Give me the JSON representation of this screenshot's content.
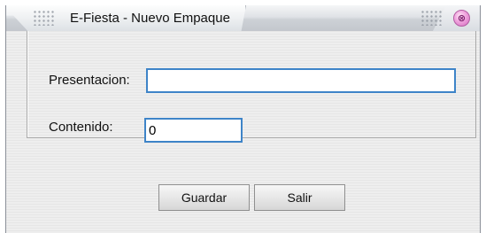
{
  "window": {
    "title": "E-Fiesta - Nuevo Empaque",
    "close_glyph": "⊗"
  },
  "form": {
    "presentacion_label": "Presentacion:",
    "presentacion_value": "",
    "contenido_label": "Contenido:",
    "contenido_value": "0"
  },
  "buttons": {
    "guardar_label": "Guardar",
    "salir_label": "Salir"
  },
  "icons": {
    "title_grip_left": "grip-dots-icon",
    "title_grip_right": "grip-dots-icon",
    "close": "close-icon"
  },
  "colors": {
    "focus_border": "#3e84c8",
    "close_button": "#f1a7df",
    "window_body": "#ebebeb"
  }
}
